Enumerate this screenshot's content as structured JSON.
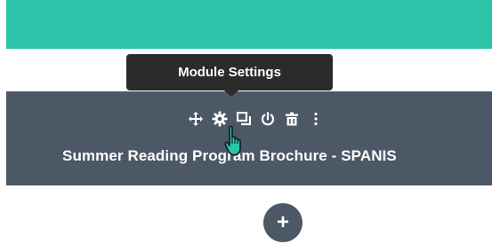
{
  "tooltip": {
    "text": "Module Settings"
  },
  "module": {
    "title": "Summer Reading Program Brochure - SPANIS",
    "toolbar": [
      {
        "icon": "move-icon"
      },
      {
        "icon": "gear-icon"
      },
      {
        "icon": "duplicate-icon"
      },
      {
        "icon": "power-icon"
      },
      {
        "icon": "trash-icon"
      },
      {
        "icon": "more-vertical-icon"
      }
    ]
  },
  "add_button": {
    "label": "+"
  },
  "colors": {
    "header_bar": "#2ec4aa",
    "module_bg": "#4c5866",
    "tooltip_bg": "#2b2b2b",
    "cursor_fill": "#2ec4aa"
  }
}
